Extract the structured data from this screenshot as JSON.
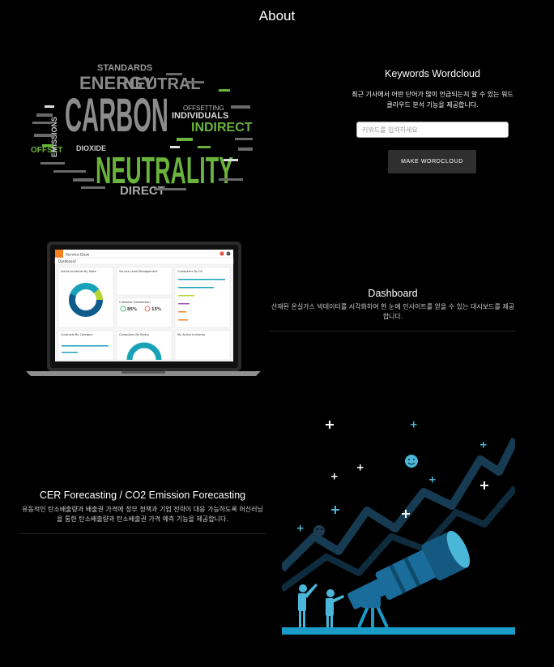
{
  "page": {
    "title": "About"
  },
  "wordcloud": {
    "heading": "Keywords Wordcloud",
    "description": "최근 기사에서 어떤 단어가 많이 언급되는지 알 수 있는 워드클라우드 분석 기능을 제공합니다.",
    "input_placeholder": "키워드를 입력하세요",
    "input_value": "",
    "button_label": "MAKE WORDCLOUD",
    "words": {
      "carbon": "CARBON",
      "neutrality": "NEUTRALITY",
      "energy": "ENERGY",
      "neutral": "NEUTRAL",
      "standards": "STANDARDS",
      "indirect": "INDIRECT",
      "individuals": "INDIVIDUALS",
      "direct": "DIRECT",
      "offset": "OFFSET",
      "offsetting": "OFFSETTING",
      "dioxide": "DIOXIDE",
      "emissions": "EMISSIONS"
    },
    "colors": {
      "green": "#6ab33c",
      "gray": "#9a9a9a",
      "white": "#ffffff"
    }
  },
  "dashboard": {
    "heading": "Dashboard",
    "description": "산재된 온실가스 빅데이터를 시각화하여 한 눈에 인사이트를 얻을 수 있는 대시보드를 제공합니다.",
    "screen": {
      "app_name": "Service Desk",
      "page_label": "Dashboard",
      "cards": {
        "incidents_by_state": "Active Incidents By State",
        "service_level": "Service Level Management",
        "computers_by_os": "Computers By OS",
        "customer_satisfaction": "Customer Satisfaction",
        "sat_percent": "85%",
        "sat_change": "15%",
        "contracts_by_category": "Contracts By Category",
        "computers_by_status": "Computers By Status",
        "my_active_incidents": "My Active Incidents"
      }
    },
    "colors": {
      "teal": "#17a2b8",
      "navy": "#0d5c8c",
      "orange": "#f58220"
    }
  },
  "forecast": {
    "heading": "CER Forecasting / CO2 Emission Forecasting",
    "description": "유동적인 탄소배출량과 배출권 가격에 정부 정책과 기업 전략이 대응 가능하도록 머신러닝을 통한 탄소배출량과 탄소배출권 가격 예측 기능을 제공합니다.",
    "colors": {
      "blue": "#1a6c9a",
      "light_blue": "#4ab6d8",
      "dark_line": "#163b52"
    }
  }
}
